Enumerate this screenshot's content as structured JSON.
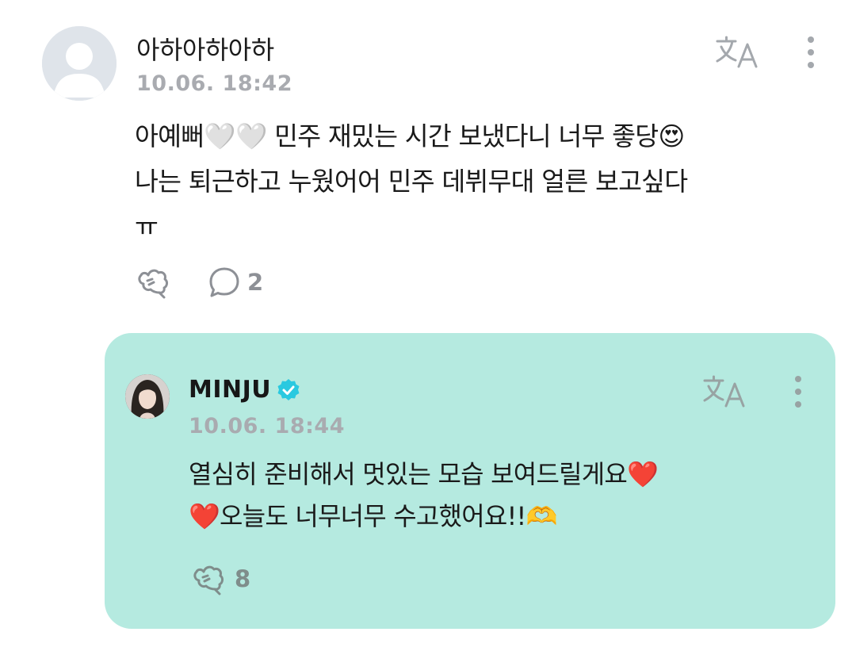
{
  "comment": {
    "author": "아하아하아하",
    "timestamp": "10.06. 18:42",
    "text_lines": [
      "아예뻐🤍🤍 민주 재밌는 시간 보냈다니 너무 좋당😍",
      "나는 퇴근하고 누웠어어 민주 데뷔무대 얼른 보고싶다",
      "ㅠ"
    ],
    "reply_count": "2",
    "icons": {
      "avatar": "default-avatar-icon",
      "translate": "translate-icon",
      "more": "more-vertical-icon",
      "like": "like-icon",
      "reply": "comment-bubble-icon"
    }
  },
  "reply": {
    "author": "MINJU",
    "verified": true,
    "timestamp": "10.06. 18:44",
    "text_lines": [
      "열심히 준비해서 멋있는 모습 보여드릴게요❤️",
      "❤️오늘도 너무너무 수고했어요!!🫶"
    ],
    "like_count": "8",
    "background_color": "#b5eae0",
    "verified_badge_color": "#29c9e0"
  }
}
